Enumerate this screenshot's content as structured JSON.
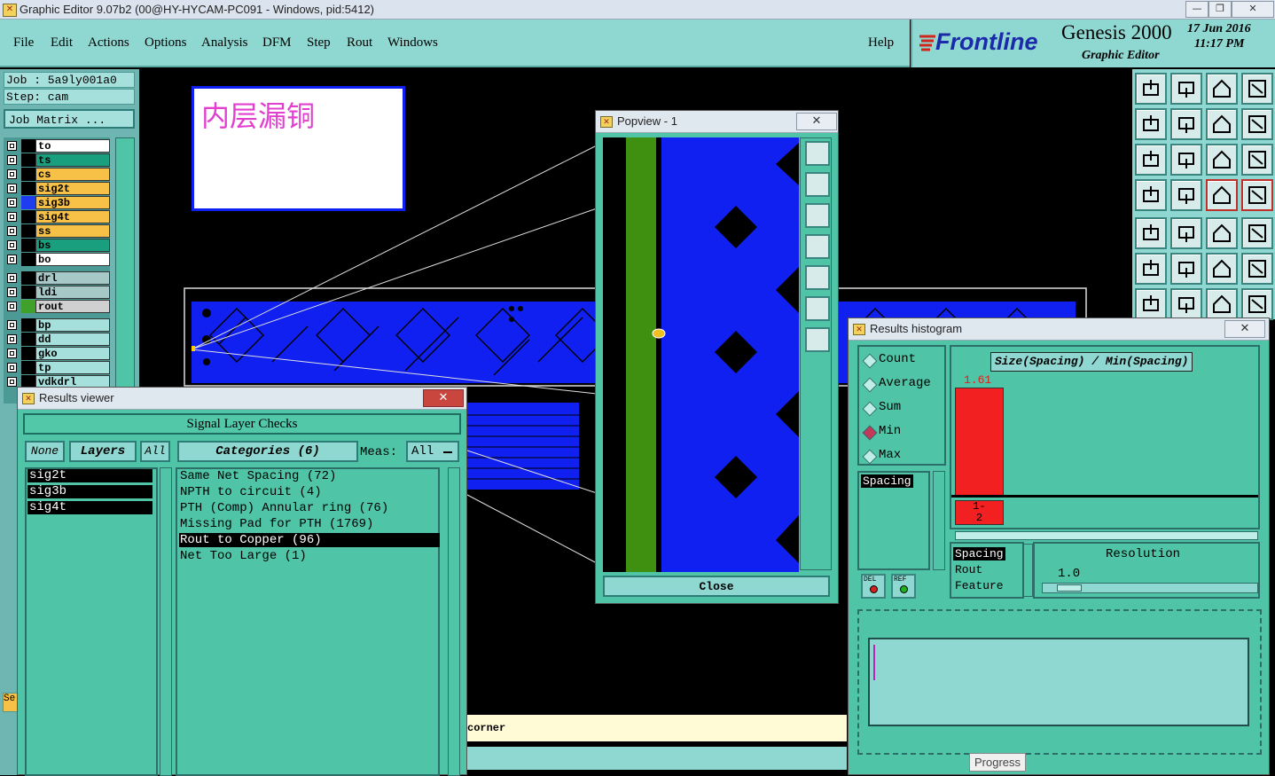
{
  "window": {
    "title": "Graphic Editor 9.07b2 (00@HY-HYCAM-PC091 - Windows, pid:5412)",
    "min": "—",
    "max": "❐",
    "close": "✕"
  },
  "menu": [
    "File",
    "Edit",
    "Actions",
    "Options",
    "Analysis",
    "DFM",
    "Step",
    "Rout",
    "Windows"
  ],
  "help": "Help",
  "brand": {
    "logo": "Frontline",
    "product": "Genesis 2000",
    "sub": "Graphic Editor",
    "date": "17  Jun 2016",
    "time": "11:17 PM"
  },
  "job": {
    "job_line": "Job : 5a9ly001a0",
    "step_line": "Step: cam",
    "matrix_button": "Job Matrix ..."
  },
  "layers": [
    {
      "name": "to",
      "color": "#ffffff",
      "swatch": "#000000"
    },
    {
      "name": "ts",
      "color": "#1a9f7e",
      "swatch": "#000000"
    },
    {
      "name": "cs",
      "color": "#f7c046",
      "swatch": "#000000"
    },
    {
      "name": "sig2t",
      "color": "#f7c046",
      "swatch": "#000000"
    },
    {
      "name": "sig3b",
      "color": "#f7c046",
      "swatch": "#1f3df0"
    },
    {
      "name": "sig4t",
      "color": "#f7c046",
      "swatch": "#000000"
    },
    {
      "name": "ss",
      "color": "#f7c046",
      "swatch": "#000000"
    },
    {
      "name": "bs",
      "color": "#1a9f7e",
      "swatch": "#000000"
    },
    {
      "name": "bo",
      "color": "#ffffff",
      "swatch": "#000000"
    },
    {
      "name": "drl",
      "color": "#a6c9c8",
      "swatch": "#000000"
    },
    {
      "name": "ldi",
      "color": "#a6c9c8",
      "swatch": "#000000"
    },
    {
      "name": "rout",
      "color": "#d0d0d0",
      "swatch": "#3fa02a"
    },
    {
      "name": "bp",
      "color": "#a6e0dc",
      "swatch": "#000000"
    },
    {
      "name": "dd",
      "color": "#a6e0dc",
      "swatch": "#000000"
    },
    {
      "name": "gko",
      "color": "#a6e0dc",
      "swatch": "#000000"
    },
    {
      "name": "tp",
      "color": "#a6e0dc",
      "swatch": "#000000"
    },
    {
      "name": "vdkdrl",
      "color": "#a6e0dc",
      "swatch": "#000000"
    }
  ],
  "annotation": {
    "text": "内层漏铜"
  },
  "status_fragment": "corner",
  "side_fragment": "Se",
  "popview": {
    "title": "Popview - 1",
    "close_button": "Close",
    "close_x": "✕"
  },
  "results_viewer": {
    "title": "Results viewer",
    "heading": "Signal Layer Checks",
    "none_btn": "None",
    "layers_btn": "Layers",
    "all_btn": "All",
    "categories_btn": "Categories (6)",
    "meas_label": "Meas:",
    "meas_value": "All",
    "layer_list": [
      "sig2t",
      "sig3b",
      "sig4t"
    ],
    "categories": [
      "Same Net Spacing (72)",
      "NPTH to circuit (4)",
      "PTH (Comp) Annular ring (76)",
      "Missing Pad for PTH (1769)",
      "Rout to Copper (96)",
      "Net Too Large (1)"
    ],
    "selected_category_index": 4
  },
  "histogram": {
    "title": "Results histogram",
    "modes": [
      "Count",
      "Average",
      "Sum",
      "Min",
      "Max"
    ],
    "selected_mode": "Min",
    "chart_title": "Size(Spacing) / Min(Spacing)",
    "bar_value": "1.61",
    "bin_label": "1-\n2",
    "list1": [
      "Spacing"
    ],
    "list2": [
      "Spacing",
      "Rout",
      "Feature"
    ],
    "resolution_label": "Resolution",
    "resolution_value": "1.0",
    "del_label": "DEL",
    "ref_label": "REF",
    "close_x": "✕"
  },
  "tooltip": "Progress",
  "colors": {
    "teal": "#4fc4a6",
    "menu": "#8fd8d2",
    "copper": "#1020f0",
    "rout": "#3f8f10"
  }
}
